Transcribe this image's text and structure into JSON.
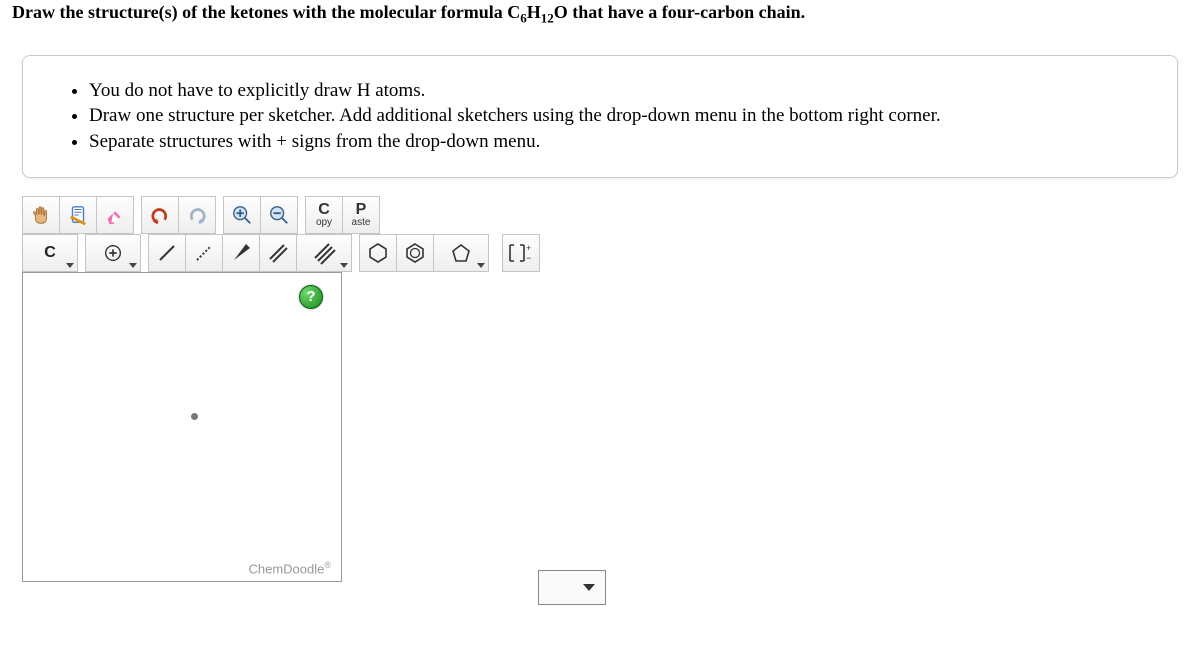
{
  "question": {
    "text_html": "Draw the structure(s) of the ketones with the molecular formula C<sub>6</sub>H<sub>12</sub>O that have a four-carbon chain."
  },
  "instructions": [
    "You do not have to explicitly draw H atoms.",
    "Draw one structure per sketcher. Add additional sketchers using the drop-down menu in the bottom right corner.",
    "Separate structures with + signs from the drop-down menu."
  ],
  "toolbar": {
    "copy_big": "C",
    "copy_small": "opy",
    "paste_big": "P",
    "paste_small": "aste",
    "element_label": "C"
  },
  "canvas": {
    "help": "?",
    "brand": "ChemDoodle",
    "brand_reg": "®"
  }
}
